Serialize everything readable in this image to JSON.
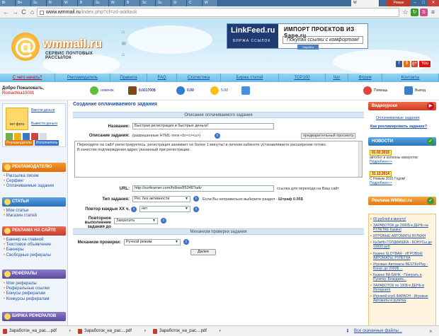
{
  "browser": {
    "tabs": [
      "Bi",
      "Be",
      "Sc",
      "N",
      "W",
      "В",
      "Sc",
      "W",
      "В",
      "Sc",
      "Sc",
      "Si",
      "С",
      "W"
    ],
    "active_tab_title": "W",
    "profile_name": "Роман",
    "url_host": "www.wmmail.ru",
    "url_path": "/index.php?cf=zd-addtask",
    "back_icon": "←",
    "forward_icon": "→",
    "reload_icon": "C",
    "home_icon": "⌂",
    "star_icon": "☆",
    "menu_icon": "≡"
  },
  "header": {
    "logo_name": "wmmail.ru",
    "logo_tagline": "СЕРВИС ПОЧТОВЫХ РАССЫЛОК",
    "banner_left_title": "LinkFeed.ru",
    "banner_left_sub": "БИРЖА ССЫЛОК",
    "banner_right_title": "ИМПОРТ ПРОЕКТОВ ИЗ Sape.ru",
    "banner_right_slogan": "Покупай ссылки с комфортом!",
    "banner_button": "Перейти",
    "socials": [
      "f",
      "В",
      "g+",
      "You"
    ]
  },
  "nav": [
    "С чего начать?",
    "Рекламодатель",
    "Правила",
    "FAQ",
    "Статистика",
    "Биржа статей",
    "TOP100",
    "Чат",
    "Форум",
    "Контакты"
  ],
  "userbar": {
    "welcome": "Добро Пожаловать,",
    "username": "Romachka10001",
    "level": "новичок",
    "balance": "0.021700$",
    "reserve": "0.00",
    "rating": "5.00",
    "help": "Помощь",
    "logout": "Выход"
  },
  "left": {
    "no_photo": "нет фото",
    "deposit": "Ввести деньги",
    "withdraw": "Вывести деньги",
    "btn_advertiser": "Рекламодатель",
    "btn_performer": "Исполнитель",
    "sections": [
      {
        "title": "РЕКЛАМОДАТЕЛЮ",
        "items": [
          "Рассылка писем",
          "Серфинг",
          "Оплачиваемые задания"
        ]
      },
      {
        "title": "СТАТЬИ",
        "items": [
          "Мои статьи",
          "Магазин статей"
        ]
      },
      {
        "title": "РЕКЛАМА НА САЙТЕ",
        "items": [
          "Баннер на главной",
          "Текстовое объявление",
          "Баннеры",
          "Свободные рефералы"
        ]
      },
      {
        "title": "РЕФЕРАЛЫ",
        "items": [
          "Мои рефералы",
          "Реферальные ссылки",
          "Бонусы рефералам",
          "Конкурсы рефералам"
        ]
      },
      {
        "title": "БИРЖА РЕФЕРАЛОВ",
        "items": []
      }
    ]
  },
  "form": {
    "page_title": "Создание оплачиваемого задания",
    "section_desc": "Описание оплачиваемого задания",
    "name_label": "Название:",
    "name_value": "Быстрая регистрация и быстрые деньги!",
    "desc_label": "Описание задания:",
    "desc_hint": "(разрешенные HTML-теги <b><i><u>)",
    "preview": "предварительный просмотр",
    "desc_value": "Переходите на сайт! регистрируетесь. регистрация занимает не более 1 минуты! в личном кабинете устанавливаете расширение готово.\nВ качестве подтверждения адрес указанный при регистрации.",
    "url_label": "URL:",
    "url_value": "http://surfearner.com/follow/85348?adv",
    "url_note": "ссылка для перехода на Ваш сайт",
    "type_label": "Тип задания:",
    "type_value": "Рег. без активности",
    "type_note": "Если Вы неправильно выберите раздел -",
    "type_fine": "Штраф 0.05$",
    "repeat_label": "Повтор каждые XX ч.",
    "repeat_value": "нет",
    "recheck_label1": "Повторное выполнение",
    "recheck_label2": "задания до проверки:",
    "recheck_value": "Запретить",
    "section_check": "Механизм проверки задания",
    "check_label": "Механизм проверки:",
    "check_value": "Ручной режим",
    "submit": "Далее"
  },
  "right": {
    "video_title": "Видеоуроки",
    "video_links": [
      "Оплачиваемые задания",
      "Как рекламировать задание?"
    ],
    "news_title": "НОВОСТИ",
    "news": [
      {
        "date": "01.02.2015",
        "text": "автобот и колонны аккаунтов",
        "more": "Подробнее>>"
      },
      {
        "date": "31.12.2014",
        "text": "С Новым 2015 Годом!",
        "more": "Подробнее>>"
      }
    ],
    "ads_title": "Реклама WMMail.ru",
    "ads": [
      "60 рублей в минуту!",
      "ЗАРАБОТОК до 2000$ в ДЕНЬ на РУЛЕТКЕ Казино",
      "ИГРОВЫЕ АВТОМАТЫ ВУЛКАН",
      "КаЗиНо ГОЛДФИШКА - БОНУСы до 10000 руб",
      "Казино SLOTBAR - ИГРОВЫЕ АВТОМАТЫ, РУЛЕТКА",
      "Игровые Автоматы BESTforPlay - Бонус до 2000$ ...",
      "Казино ВА-БАНК - Поиграть в Рулетку, Блэкджек...",
      "ЗАРАБОТОК по 100$ в ДЕНЬ в Интернете",
      "Игровой клуб ФАРАОН - Игровые Автоматы и рулетка"
    ]
  },
  "downloads": {
    "files": [
      "Заработок_на_рас....pdf",
      "Заработок_на_рас....pdf",
      "Заработок_на_рас....pdf"
    ],
    "show_all": "Все скачанные файлы...",
    "close": "×"
  }
}
